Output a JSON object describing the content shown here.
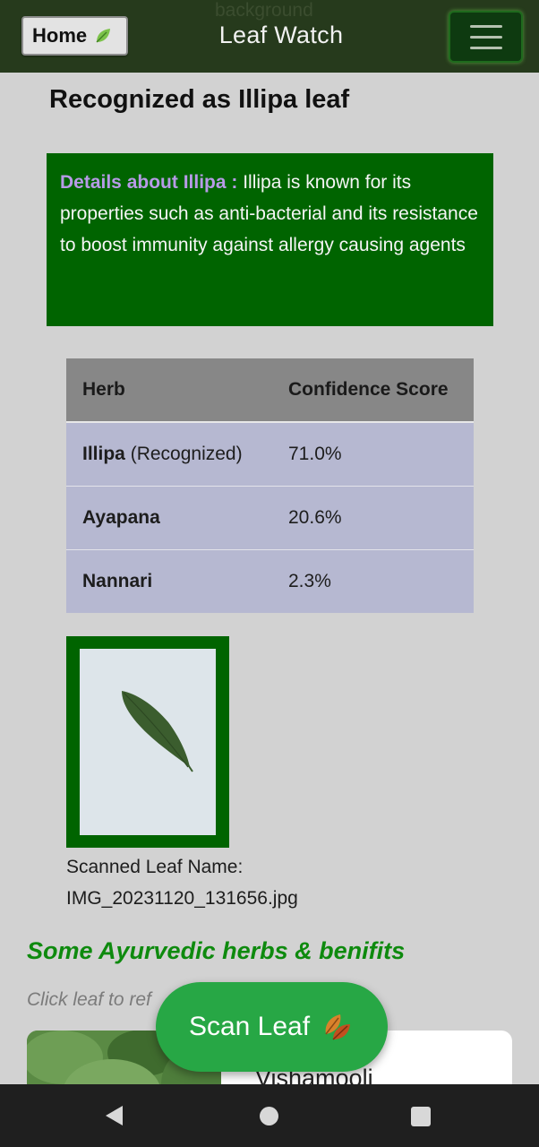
{
  "header": {
    "home_label": "Home",
    "home_icon": "leaf-icon",
    "background_label": "background",
    "title": "Leaf Watch",
    "menu_icon": "hamburger-menu-icon"
  },
  "result": {
    "title": "Recognized as Illipa leaf",
    "details_label": "Details about Illipa :",
    "details_text": "Illipa is known for its properties such as anti-bacterial and its resistance to boost immunity against allergy causing agents"
  },
  "table": {
    "headers": [
      "Herb",
      "Confidence Score"
    ],
    "rows": [
      {
        "herb": "Illipa",
        "suffix": "(Recognized)",
        "score": "71.0%"
      },
      {
        "herb": "Ayapana",
        "suffix": "",
        "score": "20.6%"
      },
      {
        "herb": "Nannari",
        "suffix": "",
        "score": "2.3%"
      }
    ]
  },
  "scan": {
    "caption_label": "Scanned Leaf Name:",
    "file_name": "IMG_20231120_131656.jpg"
  },
  "ayurvedic": {
    "heading": "Some Ayurvedic herbs & benifits",
    "hint": "Click leaf to ref",
    "card_name": "Vishamooli"
  },
  "scan_button": {
    "label": "Scan Leaf",
    "icon": "autumn-leaves-icon"
  },
  "colors": {
    "header_bg": "#263a1c",
    "details_bg": "#006400",
    "details_label": "#b79be7",
    "table_header": "#878787",
    "table_row": "#b6b8d1",
    "heading_green": "#0e8a0e",
    "scan_button": "#27a745"
  }
}
